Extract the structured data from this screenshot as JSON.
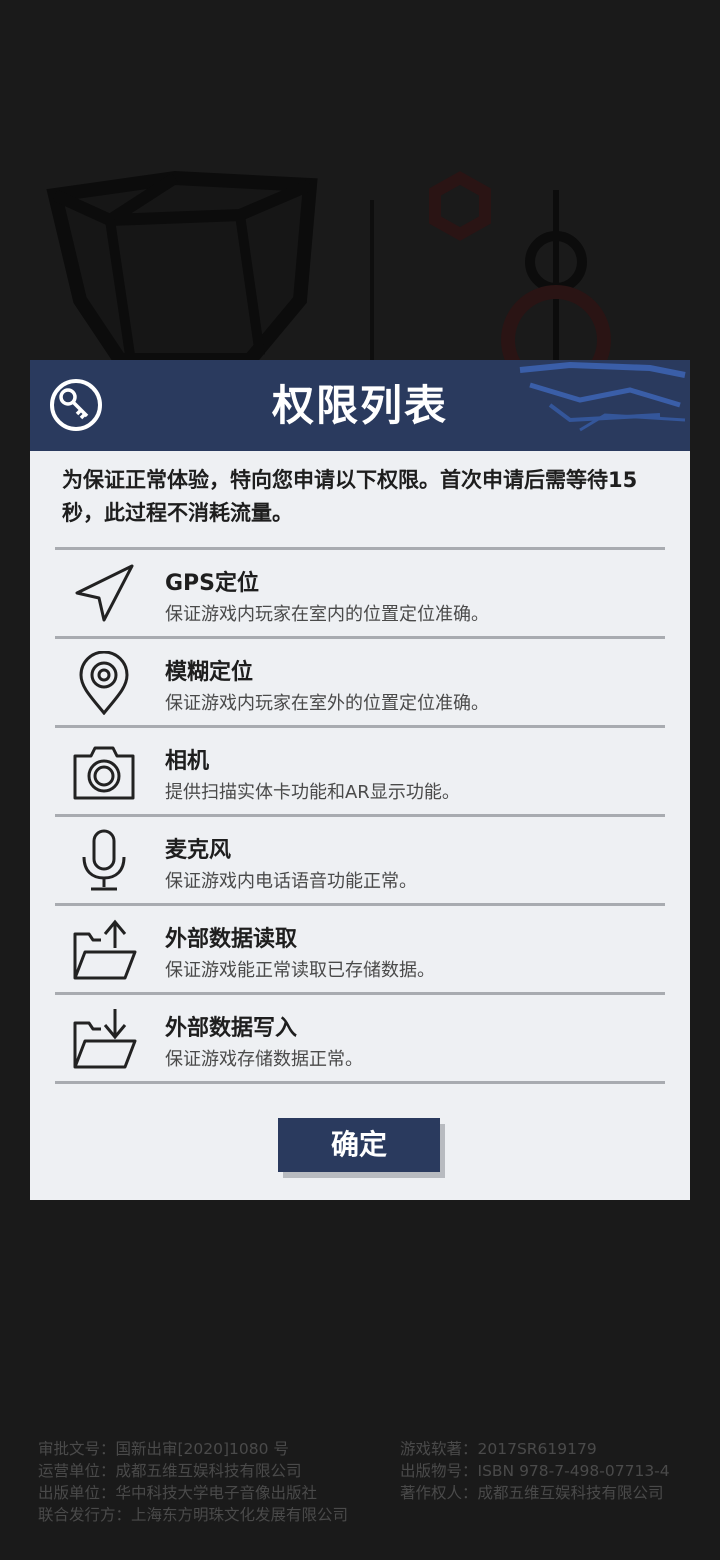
{
  "dialog": {
    "title": "权限列表",
    "intro": "为保证正常体验，特向您申请以下权限。首次申请后需等待15秒，此过程不消耗流量。",
    "confirm_label": "确定"
  },
  "permissions": [
    {
      "icon": "location-arrow-icon",
      "title": "GPS定位",
      "desc": "保证游戏内玩家在室内的位置定位准确。"
    },
    {
      "icon": "map-pin-icon",
      "title": "模糊定位",
      "desc": "保证游戏内玩家在室外的位置定位准确。"
    },
    {
      "icon": "camera-icon",
      "title": "相机",
      "desc": "提供扫描实体卡功能和AR显示功能。"
    },
    {
      "icon": "microphone-icon",
      "title": "麦克风",
      "desc": "保证游戏内电话语音功能正常。"
    },
    {
      "icon": "folder-upload-icon",
      "title": "外部数据读取",
      "desc": "保证游戏能正常读取已存储数据。"
    },
    {
      "icon": "folder-download-icon",
      "title": "外部数据写入",
      "desc": "保证游戏存储数据正常。"
    }
  ],
  "footer": {
    "left": [
      "审批文号：国新出审[2020]1080 号",
      "运营单位：成都五维互娱科技有限公司",
      "出版单位：华中科技大学电子音像出版社",
      "联合发行方：上海东方明珠文化发展有限公司"
    ],
    "right": [
      "游戏软著：2017SR619179",
      "出版物号：ISBN 978-7-498-07713-4",
      "著作权人：成都五维互娱科技有限公司"
    ]
  }
}
